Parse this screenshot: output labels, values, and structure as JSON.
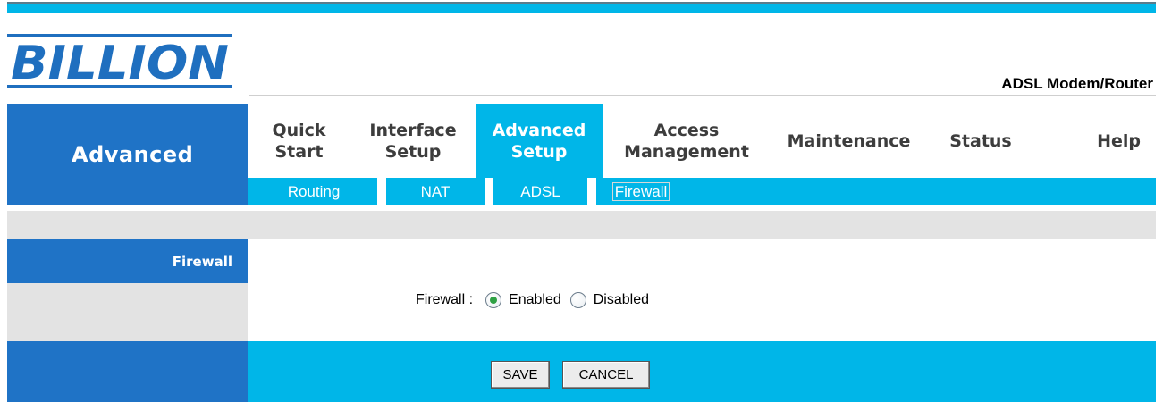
{
  "brand": {
    "logo_text": "BILLION",
    "product": "ADSL Modem/Router"
  },
  "section": {
    "title": "Advanced"
  },
  "nav": {
    "items": [
      {
        "label": "Quick\nStart",
        "active": false
      },
      {
        "label": "Interface\nSetup",
        "active": false
      },
      {
        "label": "Advanced\nSetup",
        "active": true
      },
      {
        "label": "Access\nManagement",
        "active": false
      },
      {
        "label": "Maintenance",
        "active": false
      },
      {
        "label": "Status",
        "active": false
      },
      {
        "label": "Help",
        "active": false
      }
    ]
  },
  "subnav": {
    "items": [
      {
        "label": "Routing",
        "active": false
      },
      {
        "label": "NAT",
        "active": false
      },
      {
        "label": "ADSL",
        "active": false
      },
      {
        "label": "Firewall",
        "active": true
      }
    ]
  },
  "sidebar": {
    "label": "Firewall"
  },
  "form": {
    "firewall_label": "Firewall :",
    "options": [
      {
        "label": "Enabled",
        "checked": true
      },
      {
        "label": "Disabled",
        "checked": false
      }
    ]
  },
  "buttons": {
    "save": "SAVE",
    "cancel": "CANCEL"
  },
  "colors": {
    "accent_cyan": "#00b6e8",
    "accent_blue": "#1f73c6",
    "panel_gray": "#e3e3e3"
  }
}
